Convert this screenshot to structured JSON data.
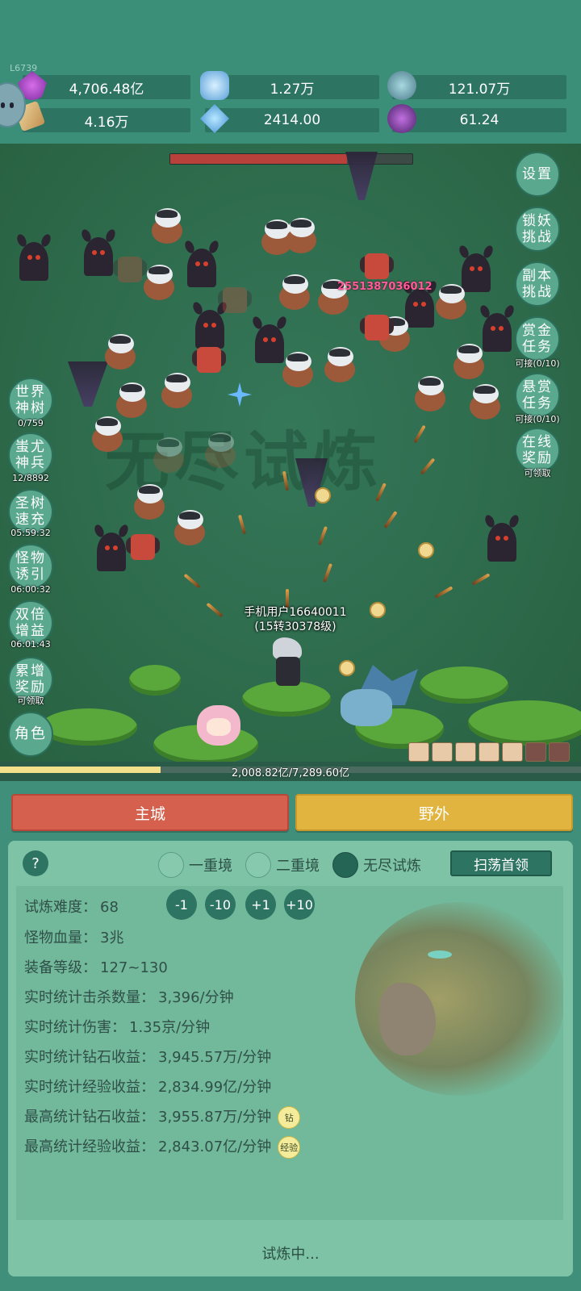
{
  "level": "L6739",
  "resources": [
    {
      "icon": "amethyst-gem-icon",
      "value": "4,706.48亿"
    },
    {
      "icon": "ice-crystal-icon",
      "value": "1.27万"
    },
    {
      "icon": "pet-orb-icon",
      "value": "121.07万"
    },
    {
      "icon": "scroll-icon",
      "value": "4.16万"
    },
    {
      "icon": "blue-diamond-icon",
      "value": "2414.00"
    },
    {
      "icon": "purple-potion-icon",
      "value": "61.24"
    }
  ],
  "battle": {
    "boss_hp_fraction": 0.73,
    "damage_number": "2551387036012",
    "player_name": "手机用户16640011",
    "player_level": "(15转30378级)",
    "exp_fraction": 0.276,
    "exp_text": "2,008.82亿/7,289.60亿"
  },
  "right_buttons": [
    {
      "label": "设置",
      "sub": ""
    },
    {
      "label": "锁妖挑战",
      "sub": ""
    },
    {
      "label": "副本挑战",
      "sub": ""
    },
    {
      "label": "赏金任务",
      "sub": "可接(0/10)"
    },
    {
      "label": "悬赏任务",
      "sub": "可接(0/10)"
    },
    {
      "label": "在线奖励",
      "sub": "可领取"
    }
  ],
  "left_buttons": [
    {
      "label": "世界神树",
      "sub": "0/759"
    },
    {
      "label": "蚩尤神兵",
      "sub": "12/8892"
    },
    {
      "label": "圣树速充",
      "sub": "05:59:32"
    },
    {
      "label": "怪物诱引",
      "sub": "06:00:32"
    },
    {
      "label": "双倍增益",
      "sub": "06:01:43"
    },
    {
      "label": "累增奖励",
      "sub": "可领取"
    },
    {
      "label": "角色",
      "sub": ""
    }
  ],
  "tabs": {
    "city": "主城",
    "wild": "野外"
  },
  "mode": {
    "help": "?",
    "options": [
      "一重境",
      "二重境",
      "无尽试炼"
    ],
    "selected_index": 2,
    "sweep_button": "扫荡首领"
  },
  "adjust_buttons": [
    "-1",
    "-10",
    "+1",
    "+10"
  ],
  "stats": [
    {
      "label": "试炼难度：",
      "value": "68"
    },
    {
      "label": "怪物血量：",
      "value": "3兆"
    },
    {
      "label": "装备等级：",
      "value": "127~130"
    },
    {
      "label": "实时统计击杀数量：",
      "value": "3,396/分钟"
    },
    {
      "label": "实时统计伤害：",
      "value": "1.35京/分钟"
    },
    {
      "label": "实时统计钻石收益：",
      "value": "3,945.57万/分钟"
    },
    {
      "label": "实时统计经验收益：",
      "value": "2,834.99亿/分钟"
    },
    {
      "label": "最高统计钻石收益：",
      "value": "3,955.87万/分钟",
      "badge": "钻"
    },
    {
      "label": "最高统计经验收益：",
      "value": "2,843.07亿/分钟",
      "badge": "经验"
    }
  ],
  "status_text": "试炼中..."
}
